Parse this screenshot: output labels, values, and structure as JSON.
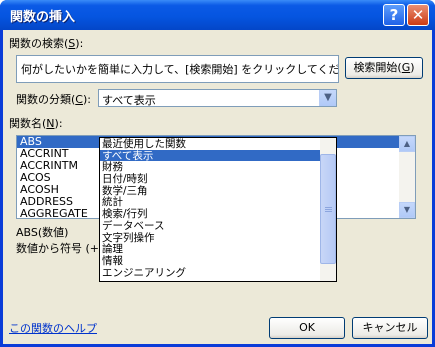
{
  "dialog": {
    "title": "関数の挿入",
    "help_button": "?",
    "close_button": "✕"
  },
  "search": {
    "label": "関数の検索(",
    "label_key": "S",
    "label_end": "):",
    "text": "何がしたいかを簡単に入力して、[検索開始] をクリックしてください。",
    "button_label": "検索開始(",
    "button_key": "G",
    "button_end": ")"
  },
  "category": {
    "label": "関数の分類(",
    "label_key": "C",
    "label_end": "):",
    "selected": "すべて表示",
    "options": [
      "最近使用した関数",
      "すべて表示",
      "財務",
      "日付/時刻",
      "数学/三角",
      "統計",
      "検索/行列",
      "データベース",
      "文字列操作",
      "論理",
      "情報",
      "エンジニアリング"
    ],
    "highlighted_index": 1
  },
  "function_list": {
    "label": "関数名(",
    "label_key": "N",
    "label_end": "):",
    "items": [
      "ABS",
      "ACCRINT",
      "ACCRINTM",
      "ACOS",
      "ACOSH",
      "ADDRESS",
      "AGGREGATE"
    ],
    "selected_index": 0
  },
  "description": {
    "syntax": "ABS(数値)",
    "text": "数値から符号 (+"
  },
  "footer": {
    "help_link": "この関数のヘルプ",
    "ok_label": "OK",
    "cancel_label": "キャンセル"
  },
  "colors": {
    "title_bar": "#0555e0",
    "selection": "#316ac5",
    "face": "#ece9d8"
  }
}
